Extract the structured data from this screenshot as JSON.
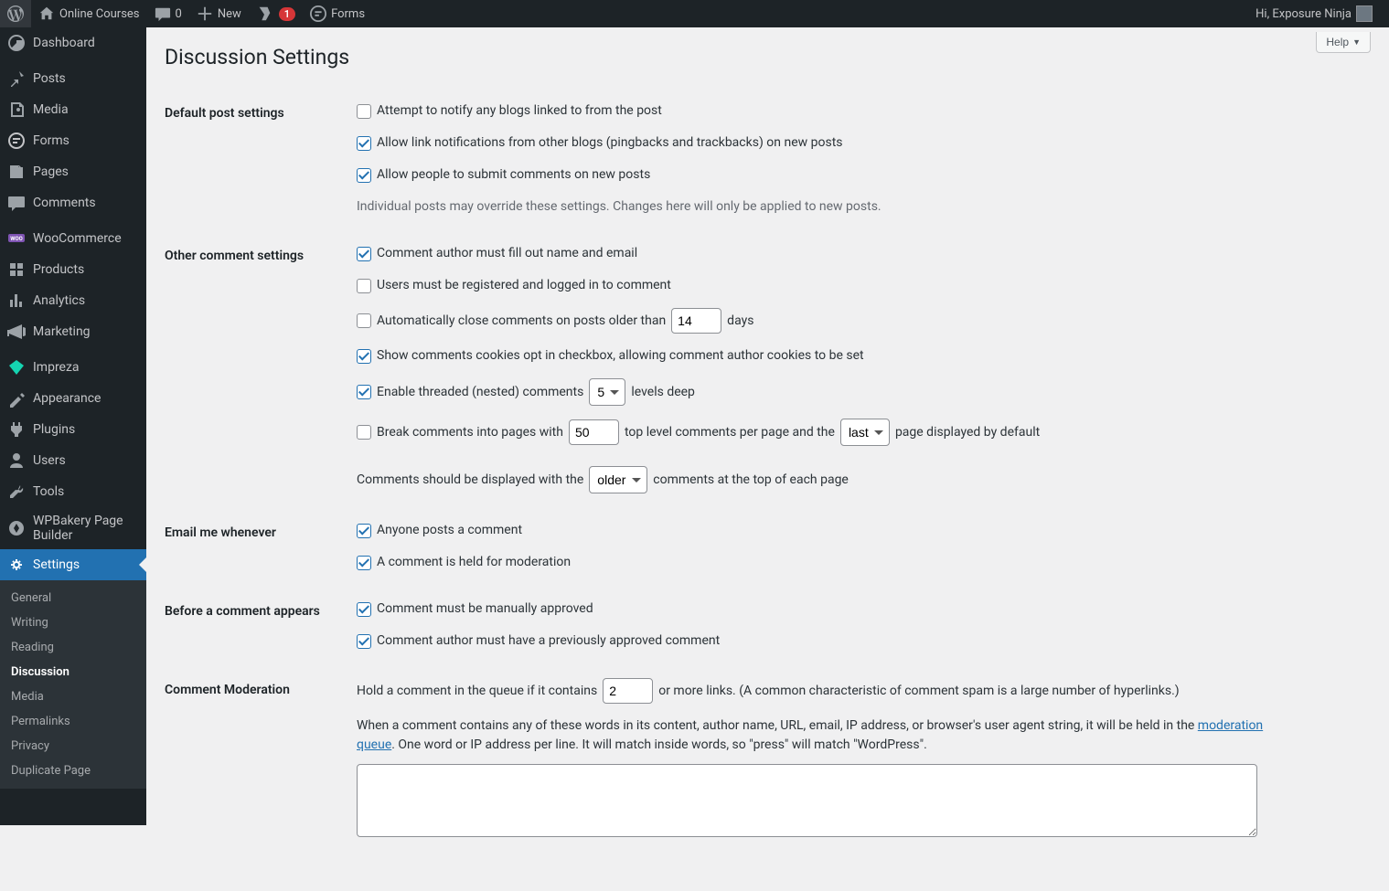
{
  "adminbar": {
    "site_name": "Online Courses",
    "comments_count": "0",
    "new_label": "New",
    "yoast_badge": "1",
    "forms_label": "Forms",
    "greeting": "Hi, Exposure Ninja"
  },
  "sidebar": {
    "items": [
      {
        "id": "dashboard",
        "label": "Dashboard"
      },
      {
        "id": "posts",
        "label": "Posts"
      },
      {
        "id": "media",
        "label": "Media"
      },
      {
        "id": "forms",
        "label": "Forms"
      },
      {
        "id": "pages",
        "label": "Pages"
      },
      {
        "id": "comments",
        "label": "Comments"
      },
      {
        "id": "woocommerce",
        "label": "WooCommerce"
      },
      {
        "id": "products",
        "label": "Products"
      },
      {
        "id": "analytics",
        "label": "Analytics"
      },
      {
        "id": "marketing",
        "label": "Marketing"
      },
      {
        "id": "impreza",
        "label": "Impreza"
      },
      {
        "id": "appearance",
        "label": "Appearance"
      },
      {
        "id": "plugins",
        "label": "Plugins"
      },
      {
        "id": "users",
        "label": "Users"
      },
      {
        "id": "tools",
        "label": "Tools"
      },
      {
        "id": "wpbakery",
        "label": "WPBakery Page Builder"
      },
      {
        "id": "settings",
        "label": "Settings"
      }
    ],
    "submenu": [
      {
        "id": "general",
        "label": "General"
      },
      {
        "id": "writing",
        "label": "Writing"
      },
      {
        "id": "reading",
        "label": "Reading"
      },
      {
        "id": "discussion",
        "label": "Discussion"
      },
      {
        "id": "media_sub",
        "label": "Media"
      },
      {
        "id": "permalinks",
        "label": "Permalinks"
      },
      {
        "id": "privacy",
        "label": "Privacy"
      },
      {
        "id": "duplicate",
        "label": "Duplicate Page"
      }
    ]
  },
  "help_label": "Help",
  "page_title": "Discussion Settings",
  "sections": {
    "default_post": {
      "heading": "Default post settings",
      "attempt_notify": "Attempt to notify any blogs linked to from the post",
      "allow_pingbacks": "Allow link notifications from other blogs (pingbacks and trackbacks) on new posts",
      "allow_comments": "Allow people to submit comments on new posts",
      "note": "Individual posts may override these settings. Changes here will only be applied to new posts."
    },
    "other": {
      "heading": "Other comment settings",
      "fill_name": "Comment author must fill out name and email",
      "registered": "Users must be registered and logged in to comment",
      "auto_close_pre": "Automatically close comments on posts older than",
      "auto_close_days": "14",
      "auto_close_post": "days",
      "cookies": "Show comments cookies opt in checkbox, allowing comment author cookies to be set",
      "threaded_pre": "Enable threaded (nested) comments",
      "threaded_select": "5",
      "threaded_post": "levels deep",
      "break_pre": "Break comments into pages with",
      "break_val": "50",
      "break_mid": "top level comments per page and the",
      "break_select": "last",
      "break_post": "page displayed by default",
      "order_pre": "Comments should be displayed with the",
      "order_select": "older",
      "order_post": "comments at the top of each page"
    },
    "email": {
      "heading": "Email me whenever",
      "anyone_posts": "Anyone posts a comment",
      "held": "A comment is held for moderation"
    },
    "before": {
      "heading": "Before a comment appears",
      "manual": "Comment must be manually approved",
      "previously": "Comment author must have a previously approved comment"
    },
    "moderation": {
      "heading": "Comment Moderation",
      "hold_pre": "Hold a comment in the queue if it contains",
      "hold_val": "2",
      "hold_post": "or more links. (A common characteristic of comment spam is a large number of hyperlinks.)",
      "blurb_pre": "When a comment contains any of these words in its content, author name, URL, email, IP address, or browser's user agent string, it will be held in the ",
      "blurb_link": "moderation queue",
      "blurb_post": ". One word or IP address per line. It will match inside words, so \"press\" will match \"WordPress\"."
    }
  }
}
